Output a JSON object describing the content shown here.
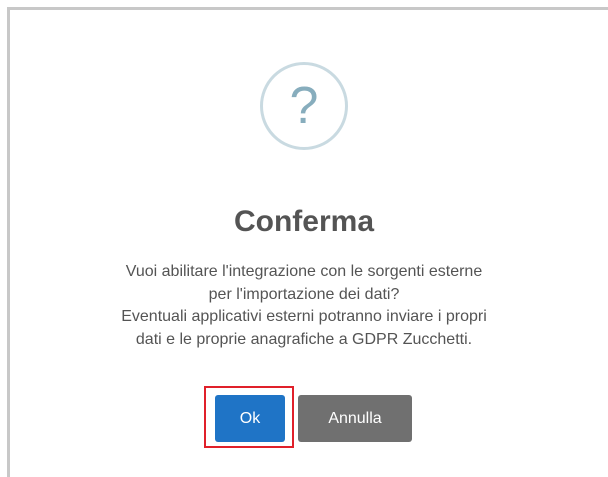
{
  "dialog": {
    "icon": "question-icon",
    "icon_glyph": "?",
    "title": "Conferma",
    "message_lines": [
      "Vuoi abilitare l'integrazione con le sorgenti esterne",
      "per l'importazione dei dati?",
      "Eventuali applicativi esterni potranno inviare i propri",
      "dati e le proprie anagrafiche a GDPR Zucchetti."
    ],
    "ok_label": "Ok",
    "cancel_label": "Annulla"
  },
  "colors": {
    "ok_button": "#1f74c6",
    "cancel_button": "#707070",
    "highlight": "#e0202a",
    "icon": "#87adbd",
    "text": "#545454"
  }
}
